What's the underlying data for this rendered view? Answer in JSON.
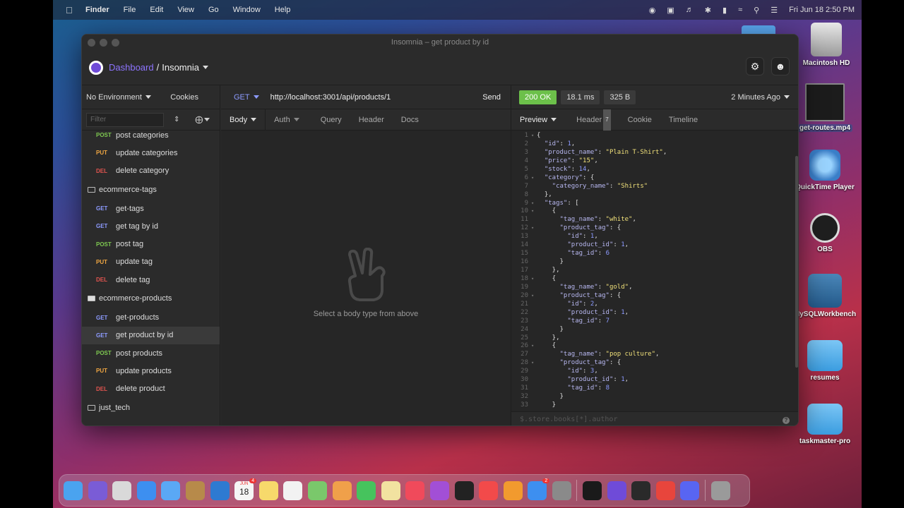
{
  "menubar": {
    "app": "Finder",
    "items": [
      "File",
      "Edit",
      "View",
      "Go",
      "Window",
      "Help"
    ],
    "clock": "Fri Jun 18  2:50 PM"
  },
  "desktop": {
    "icons": [
      {
        "label": "Macintosh HD"
      },
      {
        "label": "get-routes.mp4"
      },
      {
        "label": "QuickTime Player"
      },
      {
        "label": "OBS"
      },
      {
        "label": "MySQLWorkbench"
      },
      {
        "label": "resumes"
      },
      {
        "label": "taskmaster-pro"
      }
    ]
  },
  "window": {
    "title": "Insomnia – get product by id",
    "crumb_dashboard": "Dashboard",
    "crumb_sep": "/",
    "crumb_app": "Insomnia"
  },
  "sidebar": {
    "environment": "No Environment",
    "cookies": "Cookies",
    "filter_placeholder": "Filter",
    "groups": [
      {
        "type": "req",
        "method": "POST",
        "cls": "m-post",
        "label": "post categories"
      },
      {
        "type": "req",
        "method": "PUT",
        "cls": "m-put",
        "label": "update categories"
      },
      {
        "type": "req",
        "method": "DEL",
        "cls": "m-del",
        "label": "delete category"
      },
      {
        "type": "folder",
        "label": "ecommerce-tags",
        "open": false
      },
      {
        "type": "req",
        "method": "GET",
        "cls": "m-get",
        "label": "get-tags"
      },
      {
        "type": "req",
        "method": "GET",
        "cls": "m-get",
        "label": "get tag by id"
      },
      {
        "type": "req",
        "method": "POST",
        "cls": "m-post",
        "label": "post tag"
      },
      {
        "type": "req",
        "method": "PUT",
        "cls": "m-put",
        "label": "update tag"
      },
      {
        "type": "req",
        "method": "DEL",
        "cls": "m-del",
        "label": "delete tag"
      },
      {
        "type": "folder",
        "label": "ecommerce-products",
        "open": true
      },
      {
        "type": "req",
        "method": "GET",
        "cls": "m-get",
        "label": "get-products"
      },
      {
        "type": "req",
        "method": "GET",
        "cls": "m-get",
        "label": "get product by id",
        "active": true
      },
      {
        "type": "req",
        "method": "POST",
        "cls": "m-post",
        "label": "post products"
      },
      {
        "type": "req",
        "method": "PUT",
        "cls": "m-put",
        "label": "update products"
      },
      {
        "type": "req",
        "method": "DEL",
        "cls": "m-del",
        "label": "delete product"
      },
      {
        "type": "folder",
        "label": "just_tech",
        "open": false
      }
    ]
  },
  "request": {
    "method": "GET",
    "url": "http://localhost:3001/api/products/1",
    "send": "Send",
    "tabs": [
      "Body",
      "Auth",
      "Query",
      "Header",
      "Docs"
    ],
    "empty_text": "Select a body type from above"
  },
  "response": {
    "status": "200 OK",
    "time": "18.1 ms",
    "size": "325 B",
    "age": "2 Minutes Ago",
    "tabs": [
      "Preview",
      "Header",
      "Cookie",
      "Timeline"
    ],
    "header_count": "7",
    "filter_placeholder": "$.store.books[*].author",
    "lines": [
      "{",
      "  \"id\": 1,",
      "  \"product_name\": \"Plain T-Shirt\",",
      "  \"price\": \"15\",",
      "  \"stock\": 14,",
      "  \"category\": {",
      "    \"category_name\": \"Shirts\"",
      "  },",
      "  \"tags\": [",
      "    {",
      "      \"tag_name\": \"white\",",
      "      \"product_tag\": {",
      "        \"id\": 1,",
      "        \"product_id\": 1,",
      "        \"tag_id\": 6",
      "      }",
      "    },",
      "    {",
      "      \"tag_name\": \"gold\",",
      "      \"product_tag\": {",
      "        \"id\": 2,",
      "        \"product_id\": 1,",
      "        \"tag_id\": 7",
      "      }",
      "    },",
      "    {",
      "      \"tag_name\": \"pop culture\",",
      "      \"product_tag\": {",
      "        \"id\": 3,",
      "        \"product_id\": 1,",
      "        \"tag_id\": 8",
      "      }",
      "    }"
    ],
    "fold_lines": [
      1,
      6,
      9,
      10,
      12,
      18,
      20,
      26,
      28
    ]
  },
  "dock": {
    "apps": [
      {
        "name": "finder",
        "color": "#4aa3ef"
      },
      {
        "name": "siri",
        "color": "#7a5cd6"
      },
      {
        "name": "launchpad",
        "color": "#d9d9d9"
      },
      {
        "name": "safari",
        "color": "#3d8ff0"
      },
      {
        "name": "mail",
        "color": "#5aa8f5"
      },
      {
        "name": "notefile",
        "color": "#b78a4a"
      },
      {
        "name": "vscode",
        "color": "#2e7ad1"
      },
      {
        "name": "calendar",
        "color": "#f5f5f5"
      },
      {
        "name": "notes",
        "color": "#f7d96b"
      },
      {
        "name": "reminders",
        "color": "#f2f2f2"
      },
      {
        "name": "maps",
        "color": "#7ac86b"
      },
      {
        "name": "photos",
        "color": "#f0a04a"
      },
      {
        "name": "facetime",
        "color": "#46c35d"
      },
      {
        "name": "freeform",
        "color": "#f2e2a0"
      },
      {
        "name": "music",
        "color": "#f04a5b"
      },
      {
        "name": "podcasts",
        "color": "#a24fd6"
      },
      {
        "name": "tv",
        "color": "#222222"
      },
      {
        "name": "news",
        "color": "#f24a4a"
      },
      {
        "name": "books",
        "color": "#f29a2e"
      },
      {
        "name": "appstore",
        "color": "#3d8ff0"
      },
      {
        "name": "settings",
        "color": "#8a8a8a"
      },
      {
        "name": "terminal",
        "color": "#1a1a1a"
      },
      {
        "name": "insomnia",
        "color": "#6f4bd8"
      },
      {
        "name": "obs",
        "color": "#2a2a2a"
      },
      {
        "name": "chrome",
        "color": "#e8453c"
      },
      {
        "name": "discord",
        "color": "#5865f2"
      },
      {
        "name": "trash",
        "color": "#9a9a9a"
      }
    ],
    "calendar_day": "18",
    "calendar_month": "JUN",
    "appstore_badge": "2",
    "calendar_badge": "4"
  },
  "colors": {
    "accent": "#8d74ff",
    "ok": "#6cc04a",
    "window_bg": "#2b2b2b"
  }
}
